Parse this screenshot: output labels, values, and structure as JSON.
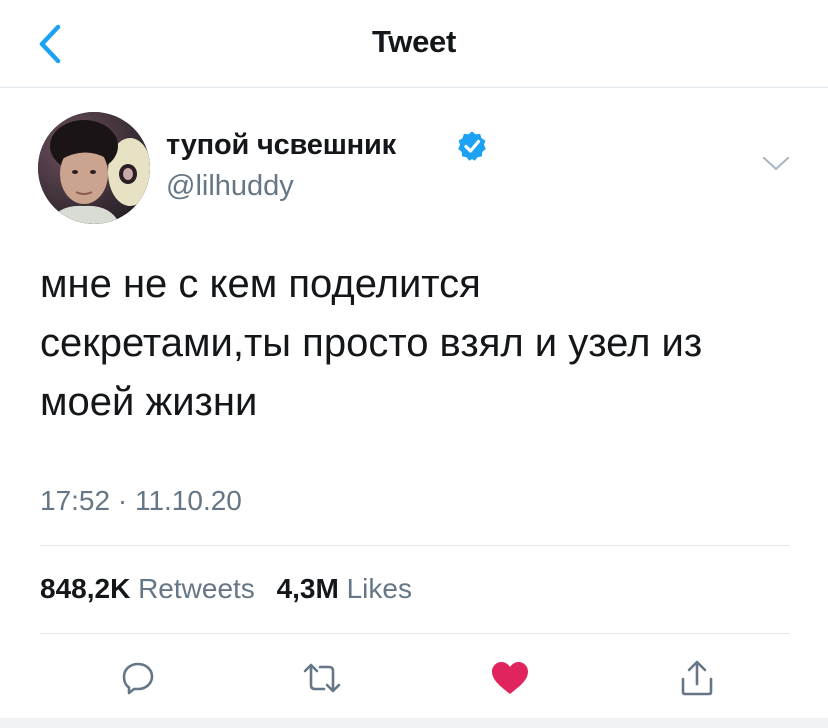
{
  "header": {
    "title": "Tweet",
    "back_icon": "chevron-left-icon"
  },
  "colors": {
    "accent": "#1da1f2",
    "text": "#14171a",
    "secondary": "#657786",
    "divider": "#e1e8ed",
    "like": "#e0245e"
  },
  "author": {
    "display_name": "тупой чсвешник",
    "handle": "@lilhuddy",
    "verified": true
  },
  "tweet": {
    "text": "мне не с кем поделится\nсекретами,ты просто взял и узел из\nмоей жизни",
    "timestamp": "17:52 · 11.10.20"
  },
  "stats": {
    "retweets_count": "848,2K",
    "retweets_label": "Retweets",
    "likes_count": "4,3M",
    "likes_label": "Likes"
  },
  "actions": [
    {
      "name": "reply",
      "icon": "reply-icon"
    },
    {
      "name": "retweet",
      "icon": "retweet-icon"
    },
    {
      "name": "like",
      "icon": "heart-icon",
      "active": true
    },
    {
      "name": "share",
      "icon": "share-icon"
    }
  ]
}
